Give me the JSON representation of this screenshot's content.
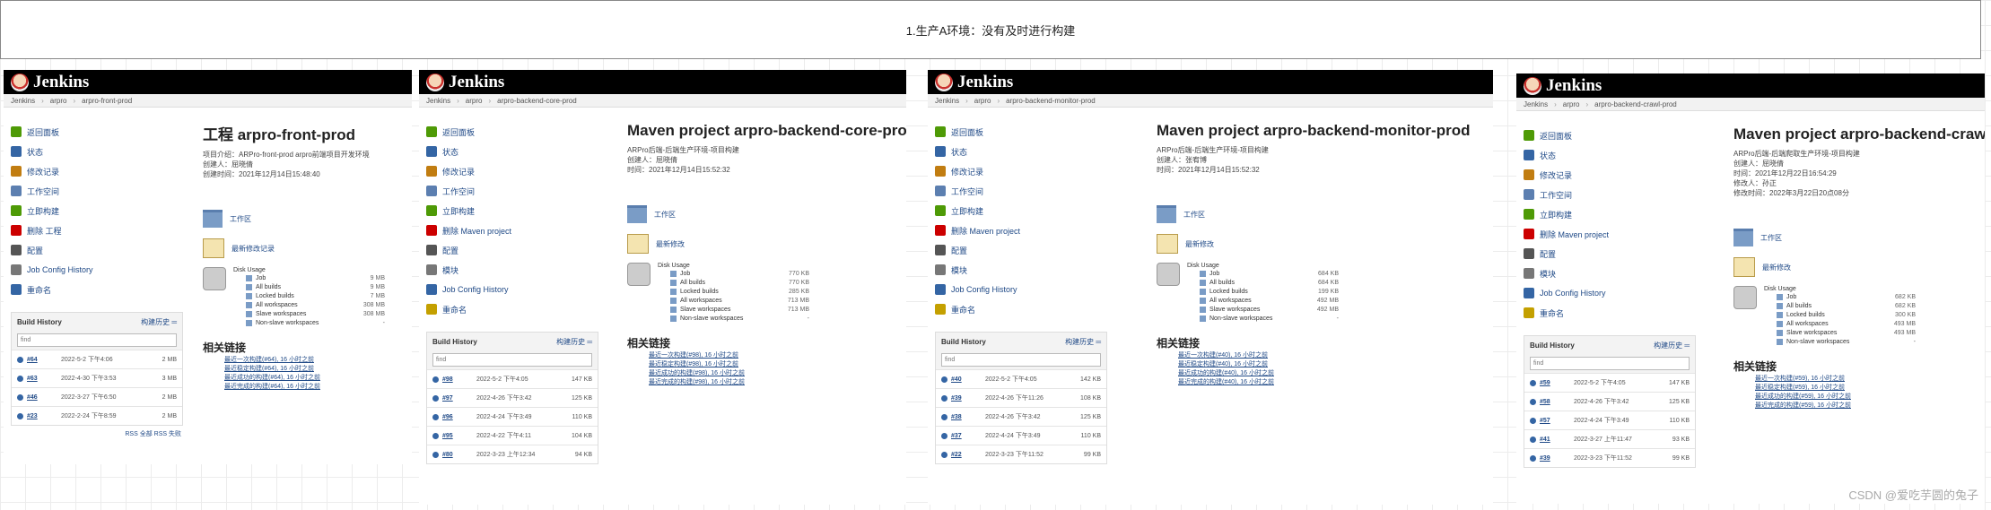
{
  "banner": "1.生产A环境：没有及时进行构建",
  "brand": "Jenkins",
  "watermark": "CSDN @爱吃芋圆的兔子",
  "panels": [
    {
      "crumbs": [
        "Jenkins",
        "arpro",
        "arpro-front-prod"
      ],
      "nav": [
        "返回面板",
        "状态",
        "修改记录",
        "工作空间",
        "立即构建",
        "删除 工程",
        "配置",
        "Job Config History",
        "重命名"
      ],
      "title": "工程 arpro-front-prod",
      "desc": [
        "项目介绍：ARPro-front-prod   arpro前端项目开发环境",
        "创建人：屈晓倩",
        "创建时间：2021年12月14日15:48:40"
      ],
      "workspace": "工作区",
      "changes": "最新修改记录",
      "disk_title": "Disk Usage",
      "disk": [
        [
          "Job",
          "9 MB"
        ],
        [
          "All builds",
          "9 MB"
        ],
        [
          "Locked builds",
          "7 MB"
        ],
        [
          "All workspaces",
          "308 MB"
        ],
        [
          "Slave workspaces",
          "308 MB"
        ],
        [
          "Non-slave workspaces",
          "-"
        ]
      ],
      "bh_title": "Build History",
      "bh_trend": "构建历史 ═",
      "find": "find",
      "builds": [
        [
          "#64",
          "2022-5-2 下午4:06",
          "2 MB"
        ],
        [
          "#63",
          "2022-4-30 下午3:53",
          "3 MB"
        ],
        [
          "#46",
          "2022-3-27 下午6:50",
          "2 MB"
        ],
        [
          "#23",
          "2022-2-24 下午8:59",
          "2 MB"
        ]
      ],
      "rss": "RSS 全部  RSS 失败",
      "rel_title": "相关链接",
      "rel": [
        "最近一次构建(#64), 16 小时之前",
        "最近稳定构建(#64), 16 小时之前",
        "最近成功的构建(#64), 16 小时之前",
        "最近完成的构建(#64), 16 小时之前"
      ]
    },
    {
      "crumbs": [
        "Jenkins",
        "arpro",
        "arpro-backend-core-prod"
      ],
      "nav": [
        "返回面板",
        "状态",
        "修改记录",
        "工作空间",
        "立即构建",
        "删除 Maven project",
        "配置",
        "模块",
        "Job Config History",
        "重命名"
      ],
      "title": "Maven project arpro-backend-core-prod",
      "desc": [
        "ARPro后端-后端生产环境-项目构建",
        "创建人：屈晓倩",
        "时间：2021年12月14日15:52:32"
      ],
      "workspace": "工作区",
      "changes": "最新修改",
      "disk_title": "Disk Usage",
      "disk": [
        [
          "Job",
          "770 KB"
        ],
        [
          "All builds",
          "770 KB"
        ],
        [
          "Locked builds",
          "285 KB"
        ],
        [
          "All workspaces",
          "713 MB"
        ],
        [
          "Slave workspaces",
          "713 MB"
        ],
        [
          "Non-slave workspaces",
          "-"
        ]
      ],
      "bh_title": "Build History",
      "bh_trend": "构建历史 ═",
      "find": "find",
      "builds": [
        [
          "#98",
          "2022-5-2 下午4:05",
          "147 KB"
        ],
        [
          "#97",
          "2022-4-26 下午3:42",
          "125 KB"
        ],
        [
          "#96",
          "2022-4-24 下午3:49",
          "110 KB"
        ],
        [
          "#95",
          "2022-4-22 下午4:11",
          "104 KB"
        ],
        [
          "#80",
          "2022-3-23 上午12:34",
          "94 KB"
        ]
      ],
      "rss": "",
      "rel_title": "相关链接",
      "rel": [
        "最近一次构建(#98), 16 小时之前",
        "最近稳定构建(#98), 16 小时之前",
        "最近成功的构建(#98), 16 小时之前",
        "最近完成的构建(#98), 16 小时之前"
      ]
    },
    {
      "crumbs": [
        "Jenkins",
        "arpro",
        "arpro-backend-monitor-prod"
      ],
      "nav": [
        "返回面板",
        "状态",
        "修改记录",
        "工作空间",
        "立即构建",
        "删除 Maven project",
        "配置",
        "模块",
        "Job Config History",
        "重命名"
      ],
      "title": "Maven project arpro-backend-monitor-prod",
      "desc": [
        "ARPro后端-后端生产环境-项目构建",
        "创建人：张宥博",
        "时间：2021年12月14日15:52:32"
      ],
      "workspace": "工作区",
      "changes": "最新修改",
      "disk_title": "Disk Usage",
      "disk": [
        [
          "Job",
          "684 KB"
        ],
        [
          "All builds",
          "684 KB"
        ],
        [
          "Locked builds",
          "199 KB"
        ],
        [
          "All workspaces",
          "492 MB"
        ],
        [
          "Slave workspaces",
          "492 MB"
        ],
        [
          "Non-slave workspaces",
          "-"
        ]
      ],
      "bh_title": "Build History",
      "bh_trend": "构建历史 ═",
      "find": "find",
      "builds": [
        [
          "#40",
          "2022-5-2 下午4:05",
          "142 KB"
        ],
        [
          "#39",
          "2022-4-26 下午11:26",
          "108 KB"
        ],
        [
          "#38",
          "2022-4-26 下午3:42",
          "125 KB"
        ],
        [
          "#37",
          "2022-4-24 下午3:49",
          "110 KB"
        ],
        [
          "#22",
          "2022-3-23 下午11:52",
          "99 KB"
        ]
      ],
      "rss": "",
      "rel_title": "相关链接",
      "rel": [
        "最近一次构建(#40), 16 小时之前",
        "最近稳定构建(#40), 16 小时之前",
        "最近成功的构建(#40), 16 小时之前",
        "最近完成的构建(#40), 16 小时之前"
      ]
    },
    {
      "crumbs": [
        "Jenkins",
        "arpro",
        "arpro-backend-crawl-prod"
      ],
      "nav": [
        "返回面板",
        "状态",
        "修改记录",
        "工作空间",
        "立即构建",
        "删除 Maven project",
        "配置",
        "模块",
        "Job Config History",
        "重命名"
      ],
      "title": "Maven project arpro-backend-crawl",
      "desc": [
        "ARPro后端-后端爬取生产环境-项目构建",
        "创建人：屈晓倩",
        "时间：2021年12月22日16:54:29",
        "修改人：孙正",
        "修改时间：2022年3月22日20点08分"
      ],
      "workspace": "工作区",
      "changes": "最新修改",
      "disk_title": "Disk Usage",
      "disk": [
        [
          "Job",
          "682 KB"
        ],
        [
          "All builds",
          "682 KB"
        ],
        [
          "Locked builds",
          "300 KB"
        ],
        [
          "All workspaces",
          "493 MB"
        ],
        [
          "Slave workspaces",
          "493 MB"
        ],
        [
          "Non-slave workspaces",
          "-"
        ]
      ],
      "bh_title": "Build History",
      "bh_trend": "构建历史 ═",
      "find": "find",
      "builds": [
        [
          "#59",
          "2022-5-2 下午4:05",
          "147 KB"
        ],
        [
          "#58",
          "2022-4-26 下午3:42",
          "125 KB"
        ],
        [
          "#57",
          "2022-4-24 下午3:49",
          "110 KB"
        ],
        [
          "#41",
          "2022-3-27 上午11:47",
          "93 KB"
        ],
        [
          "#39",
          "2022-3-23 下午11:52",
          "99 KB"
        ]
      ],
      "rss": "",
      "rel_title": "相关链接",
      "rel": [
        "最近一次构建(#59), 16 小时之前",
        "最近稳定构建(#59), 16 小时之前",
        "最近成功的构建(#59), 16 小时之前",
        "最近完成的构建(#59), 16 小时之前"
      ]
    }
  ]
}
